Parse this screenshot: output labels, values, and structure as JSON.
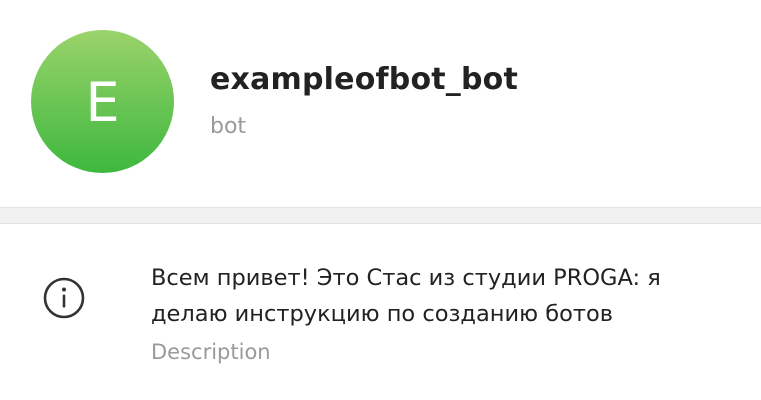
{
  "profile": {
    "avatar_letter": "E",
    "name": "exampleofbot_bot",
    "subtitle": "bot",
    "avatar_colors": [
      "#9bd36b",
      "#3db83e"
    ]
  },
  "info": {
    "icon": "info-icon",
    "description_line1": "Всем привет! Это Стас из студии PROGA: я",
    "description_line2": "делаю инструкцию по созданию ботов",
    "label": "Description"
  }
}
